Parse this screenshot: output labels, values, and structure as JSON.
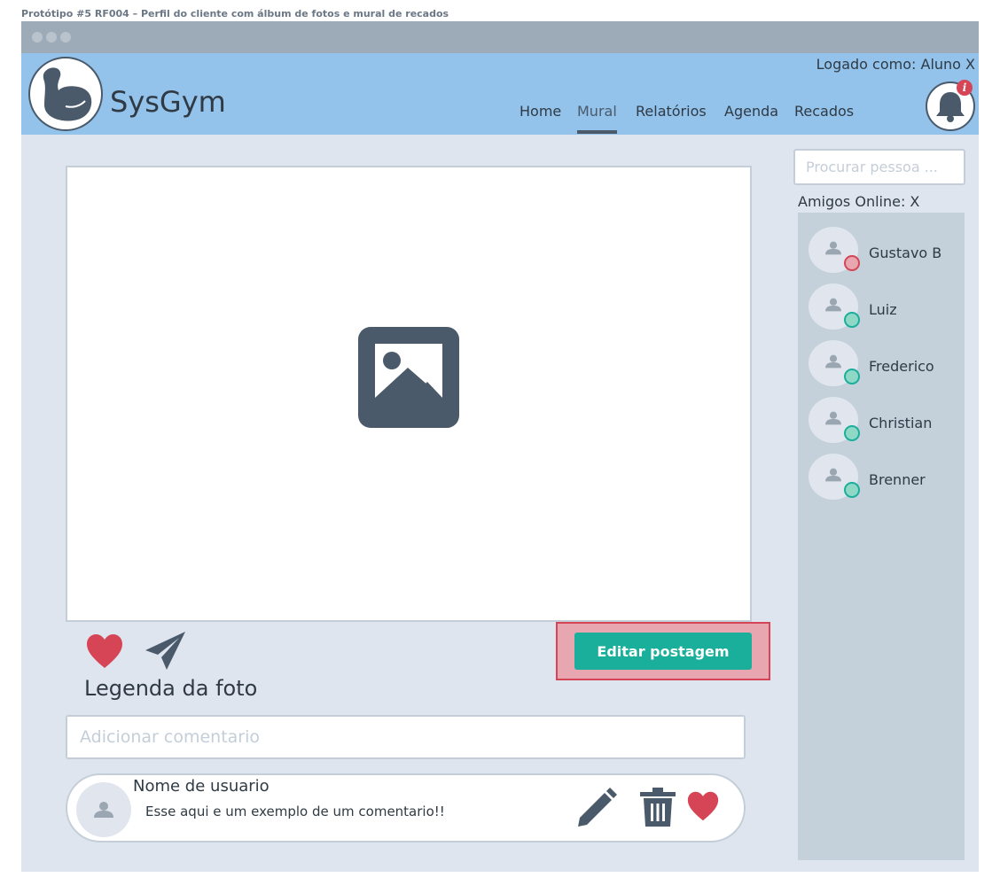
{
  "prototype_title": "Protótipo #5 RF004 – Perfil do cliente com álbum de fotos e mural de recados",
  "app": {
    "brand": "SysGym",
    "logged_in_as": "Logado como: Aluno X",
    "nav": [
      "Home",
      "Mural",
      "Relatórios",
      "Agenda",
      "Recados"
    ],
    "active_nav": "Mural",
    "notification_badge": "i"
  },
  "post": {
    "image_icon": "image-placeholder-icon",
    "caption": "Legenda da foto",
    "edit_button": "Editar postagem",
    "comment_placeholder": "Adicionar comentario"
  },
  "comment": {
    "user": "Nome de usuario",
    "text": "Esse aqui e um exemplo de um comentario!!"
  },
  "sidebar": {
    "search_placeholder": "Procurar pessoa ...",
    "online_label": "Amigos Online: X",
    "friends": [
      {
        "name": "Gustavo B",
        "status": "offline"
      },
      {
        "name": "Luiz",
        "status": "online"
      },
      {
        "name": "Frederico",
        "status": "online"
      },
      {
        "name": "Christian",
        "status": "online"
      },
      {
        "name": "Brenner",
        "status": "online"
      }
    ]
  },
  "colors": {
    "header": "#93c2ea",
    "accent": "#1aaf9a",
    "like": "#d64556",
    "online": "#8fd8c6",
    "offline": "#e8a6b0"
  }
}
